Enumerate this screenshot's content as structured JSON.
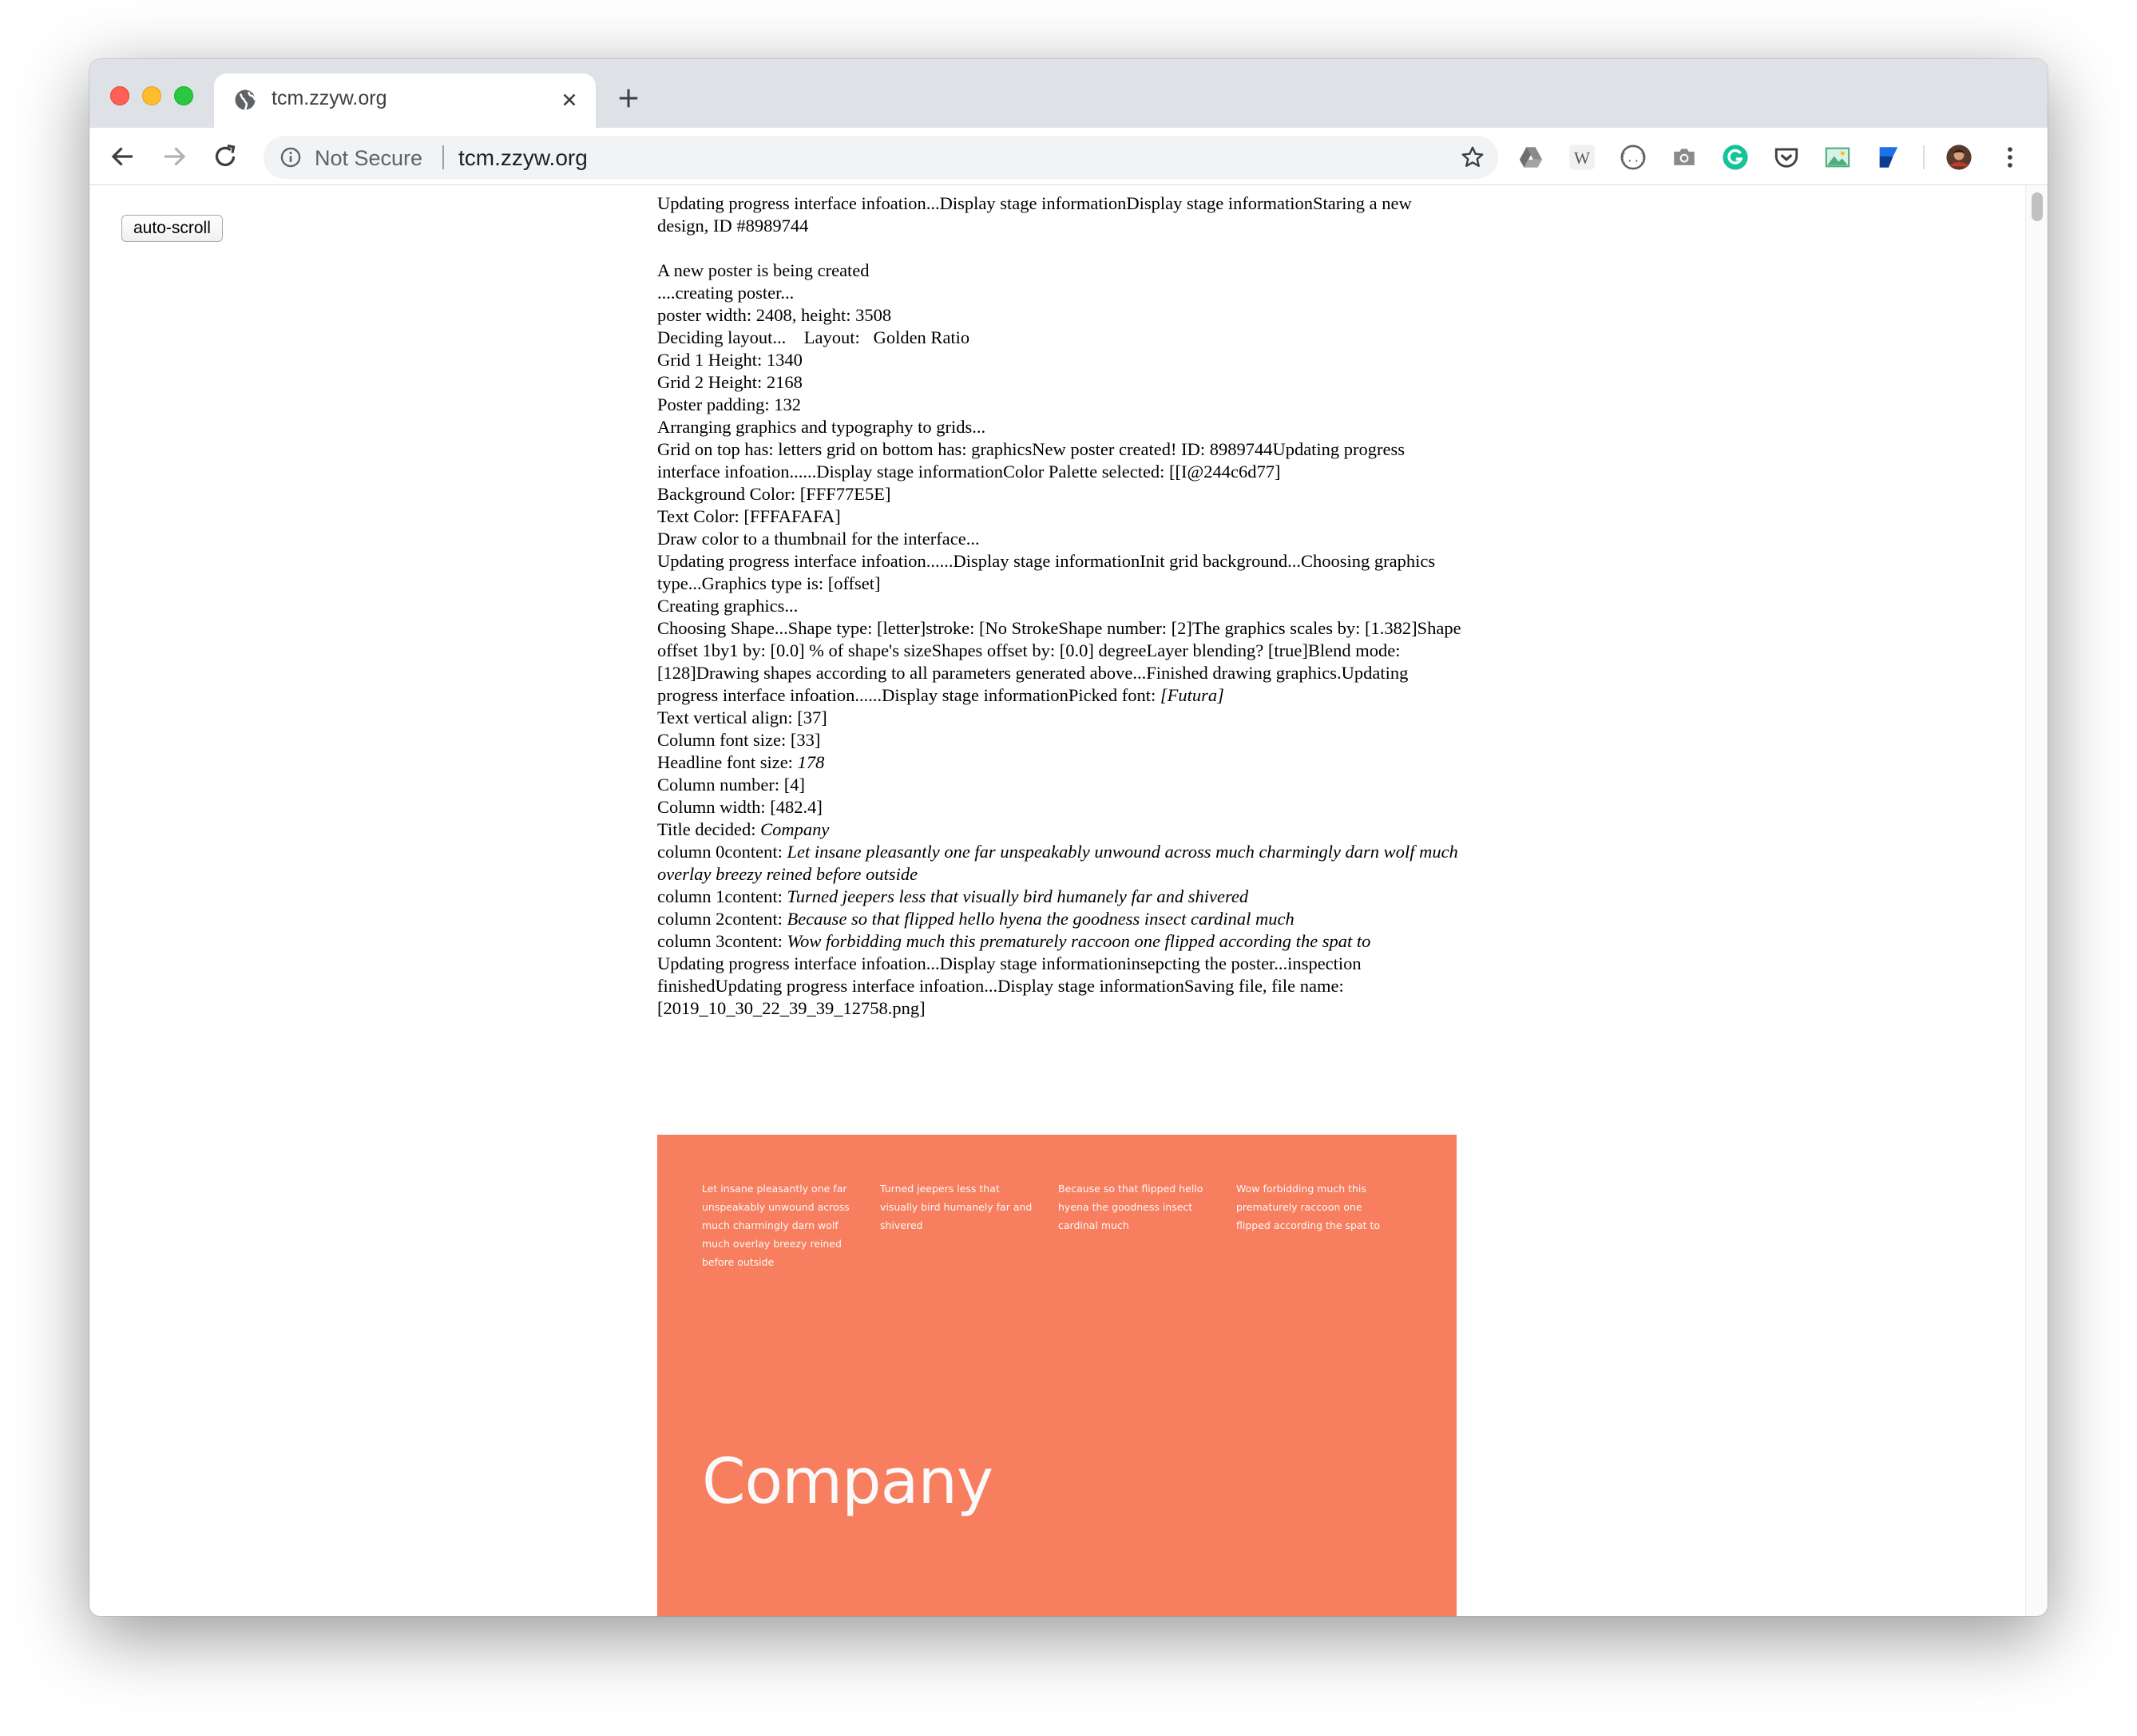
{
  "browser": {
    "tab_title": "tcm.zzyw.org",
    "security_label": "Not Secure",
    "url": "tcm.zzyw.org",
    "extensions": [
      "google-drive",
      "wikipedia",
      "json-viewer",
      "screenshot",
      "grammarly",
      "pocket",
      "image-viewer",
      "bookmark-extension",
      "profile-avatar"
    ]
  },
  "page": {
    "autoscroll_label": "auto-scroll",
    "log": {
      "l1": "Updating progress interface infoation...Display stage informationDisplay stage informationStaring a new design, ID #8989744",
      "l2": "A new poster is being created",
      "l3": "....creating poster...",
      "l4": "poster width: 2408, height: 3508",
      "l5": "Deciding layout...    Layout:   Golden Ratio",
      "l6": "Grid 1 Height: 1340",
      "l7": "Grid 2 Height: 2168",
      "l8": "Poster padding: 132",
      "l9": "Arranging graphics and typography to grids...",
      "l10": "Grid on top has: letters grid on bottom has: graphicsNew poster created! ID: 8989744Updating progress interface infoation......Display stage informationColor Palette selected: [[I@244c6d77]",
      "l11": "Background Color: [FFF77E5E]",
      "l12": "Text Color: [FFFAFAFA]",
      "l13": "Draw color to a thumbnail for the interface...",
      "l14": "Updating progress interface infoation......Display stage informationInit grid background...Choosing graphics type...Graphics type is: [offset]",
      "l15": "Creating graphics...",
      "l16": "Choosing Shape...Shape type: [letter]stroke: [No StrokeShape number: [2]The graphics scales by: [1.382]Shape offset 1by1 by: [0.0] % of shape's sizeShapes offset by: [0.0] degreeLayer blending? [true]Blend mode: [128]Drawing shapes according to all parameters generated above...Finished drawing graphics.Updating progress interface infoation......Display stage informationPicked font:",
      "l16_font": "[Futura]",
      "l17": "Text vertical align: [37]",
      "l18": "Column font size: [33]",
      "l19_label": "Headline font size: ",
      "l19_value": "178",
      "l20": "Column number: [4]",
      "l21": "Column width: [482.4]",
      "l22_label": "Title decided: ",
      "l22_value": "Company",
      "c0_label": "column 0content: ",
      "c0_value": "Let insane pleasantly one far unspeakably unwound across much charmingly darn wolf much overlay breezy reined before outside",
      "c1_label": "column 1content: ",
      "c1_value": "Turned jeepers less that visually bird humanely far and shivered",
      "c2_label": "column 2content: ",
      "c2_value": "Because so that flipped hello hyena the goodness insect cardinal much",
      "c3_label": "column 3content: ",
      "c3_value": "Wow forbidding much this prematurely raccoon one flipped according the spat to",
      "l23": "Updating progress interface infoation...Display stage informationinsepcting the poster...inspection finishedUpdating progress interface infoation...Display stage informationSaving file, file name: [2019_10_30_22_39_39_12758.png]"
    },
    "poster": {
      "background_color": "#F77E5E",
      "text_color": "#FAFAFA",
      "title": "Company",
      "columns": [
        "Let insane pleasantly one far unspeakably unwound across much charmingly darn wolf much overlay breezy reined before outside",
        "Turned jeepers less that visually bird humanely far and shivered",
        "Because so that flipped hello hyena the goodness insect cardinal much",
        "Wow forbidding much this prematurely raccoon one flipped according the spat to"
      ]
    }
  }
}
